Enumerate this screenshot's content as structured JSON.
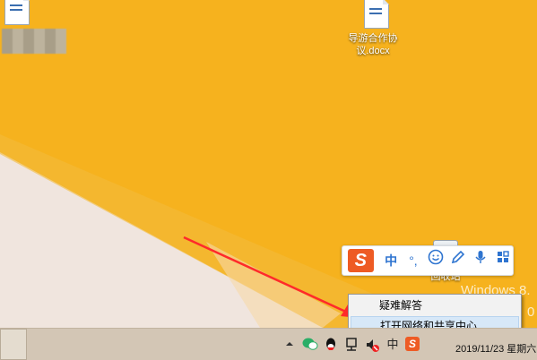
{
  "desktop": {
    "doc_icon": {
      "label_line1": "导游合作协",
      "label_line2": "议.docx"
    },
    "recycle_bin": {
      "label": "回收站"
    },
    "watermark": {
      "line1": "Windows 8.",
      "line2": "0"
    }
  },
  "ime": {
    "logo": "S",
    "mode": "中",
    "punct": "°,",
    "emoji_icon": "smiley-icon",
    "pen_icon": "pen-icon",
    "mic_icon": "microphone-icon",
    "grid_icon": "grid-icon"
  },
  "context_menu": {
    "items": [
      "疑难解答",
      "打开网络和共享中心"
    ]
  },
  "taskbar": {
    "tray_ime": "中",
    "clock": "2019/11/23 星期六"
  },
  "colors": {
    "desktop": "#f6b21e",
    "accent_red": "#ee5b24",
    "menu_highlight": "#d7e8f8"
  }
}
